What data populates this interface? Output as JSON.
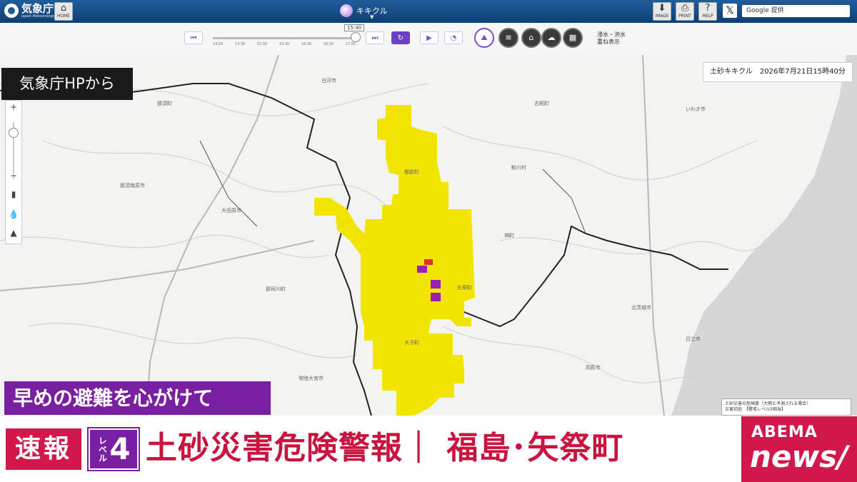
{
  "topbar": {
    "agency_name": "気象庁",
    "agency_sub": "Japan Meteorological Agency",
    "home_label": "HOME",
    "product_title": "キキクル",
    "image_label": "IMAGE",
    "print_label": "PRINT",
    "help_label": "HELP",
    "search_placeholder": "Google 提供"
  },
  "controls": {
    "time_label": "15:40",
    "ticks": [
      "14:00",
      "14:30",
      "15:00",
      "15:30",
      "16:00",
      "16:30",
      "17:00"
    ],
    "overlay_line1": "浸水・洪水",
    "overlay_line2": "重ね表示"
  },
  "map": {
    "hp_badge": "気象庁HPから",
    "zoom_in": "+",
    "zoom_out": "−",
    "timestamp": "土砂キキクル　2026年7月21日15時40分",
    "legend_line1": "土砂災害の危険度（大雨と予測される場合）",
    "legend_line2": "災害切迫　【警戒レベル5相当】",
    "place_labels": [
      "那須塩原市",
      "大田原市",
      "棚倉町",
      "矢祭町",
      "大子町",
      "常陸大宮市",
      "北茨城市",
      "高萩市",
      "日立市",
      "塙町",
      "鮫川村",
      "古殿町",
      "いわき市",
      "那珂川町",
      "那須町",
      "白河市"
    ]
  },
  "banner": {
    "sub": "早めの避難を心がけて",
    "sokuho": "速報",
    "level_label": "レベル",
    "level_num": "4",
    "headline": "土砂災害危険警報｜ 福島･矢祭町",
    "brand_top": "ABEMA",
    "brand_bottom": "news/"
  },
  "colors": {
    "warning_yellow": "#f2e600",
    "danger_purple": "#9b1fb5",
    "extreme_red": "#e03020",
    "brand_pink": "#d3174b",
    "level_purple": "#7a1fa2"
  }
}
